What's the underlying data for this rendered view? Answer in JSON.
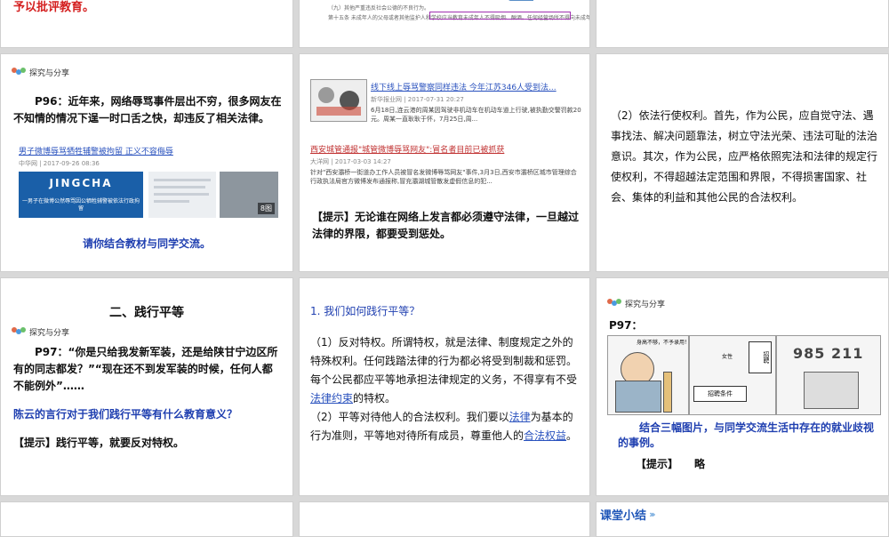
{
  "row0": {
    "left_text": "予以批评教育。",
    "mid_lines": [
      "（九）其他严重违反社会公德的不良行为。",
      "第十五条 未成年人的父母或者其他监护人和学校应当教育未成年人不得吸烟、酗酒。任何经营场所不得向未成年人出售烟酒。"
    ]
  },
  "share_label": "探究与分享",
  "slide_p96": {
    "text": "P96：近年来，网络辱骂事件层出不穷，很多网友在不知情的情况下逞一时口舌之快，却违反了相关法律。",
    "news_title": "男子微博辱骂牺牲辅警被拘留 正义不容侮辱",
    "news_meta": "中华网 | 2017-09-26 08:36",
    "banner_text": "JINGCHA",
    "banner_caption": "一男子在微博公然辱骂因公牺牲辅警被依法行政拘留",
    "img_count": "8图",
    "prompt": "请你结合教材与同学交流。"
  },
  "slide_news": {
    "news1_title": "线下线上辱骂警察同样违法 今年江苏346人受到法...",
    "news1_meta": "新华报业网 | 2017-07-31 20:27",
    "news1_snippet": "6月18日,连云港的周某因驾驶非机动车在机动车道上行驶,被执勤交警罚款20元。周某一直耿耿于怀，7月25日,周...",
    "news2_title": "西安城管通报\"城管微博辱骂网友\":冒名者目前已被抓获",
    "news2_meta": "大洋网 | 2017-03-03 14:27",
    "news2_snippet": "针对\"西安灞桥一街道办工作人员被冒名发微博辱骂网友\"事件,3月3日,西安市灞桥区城市管理综合行政执法局官方微博发布通报称,冒充灞湖城管散发虚假信息的犯...",
    "hint": "【提示】无论谁在网络上发言都必须遵守法律，一旦越过法律的界限，都要受到惩处。"
  },
  "slide_rights": {
    "text": "（2）依法行使权利。首先，作为公民，应自觉守法、遇事找法、解决问题靠法，树立守法光荣、违法可耻的法治意识。其次，作为公民，应严格依照宪法和法律的规定行使权利，不得超越法定范围和界限，不得损害国家、社会、集体的利益和其他公民的合法权利。"
  },
  "slide_equal": {
    "title": "二、践行平等",
    "p97_text": "P97：“你是只给我发新军装，还是给陕甘宁边区所有的同志都发？”“现在还不到发军装的时候，任何人都不能例外”……",
    "question": "陈云的言行对于我们践行平等有什么教育意义？",
    "hint": "【提示】践行平等，就要反对特权。"
  },
  "slide_how": {
    "heading": "1. 我们如何践行平等？",
    "p1_before": "（1）反对特权。所谓特权，就是法律、制度规定之外的特殊权利。任何践踏法律的行为都必将受到制裁和惩罚。每个公民都应平等地承担法律规定的义务，不得享有不受",
    "p1_link": "法律约束",
    "p1_after": "的特权。",
    "p2_before": "（2）平等对待他人的合法权利。我们要以",
    "p2_link1": "法律",
    "p2_mid": "为基本的行为准则，平等地对待所有成员，尊重他人的",
    "p2_link2": "合法权益",
    "p2_end": "。"
  },
  "slide_p97": {
    "label": "P97：",
    "cartoon1_caption": "身高不够，不予录用！",
    "cartoon2_sign": "招聘条件",
    "cartoon2_tag": "女性",
    "cartoon2_recruit": "招聘",
    "cartoon3_text": "985 211",
    "prompt": "结合三幅图片，与同学交流生活中存在的就业歧视的事例。",
    "hint_label": "【提示】",
    "hint_text": "略"
  },
  "summary": {
    "label": "课堂小结"
  }
}
